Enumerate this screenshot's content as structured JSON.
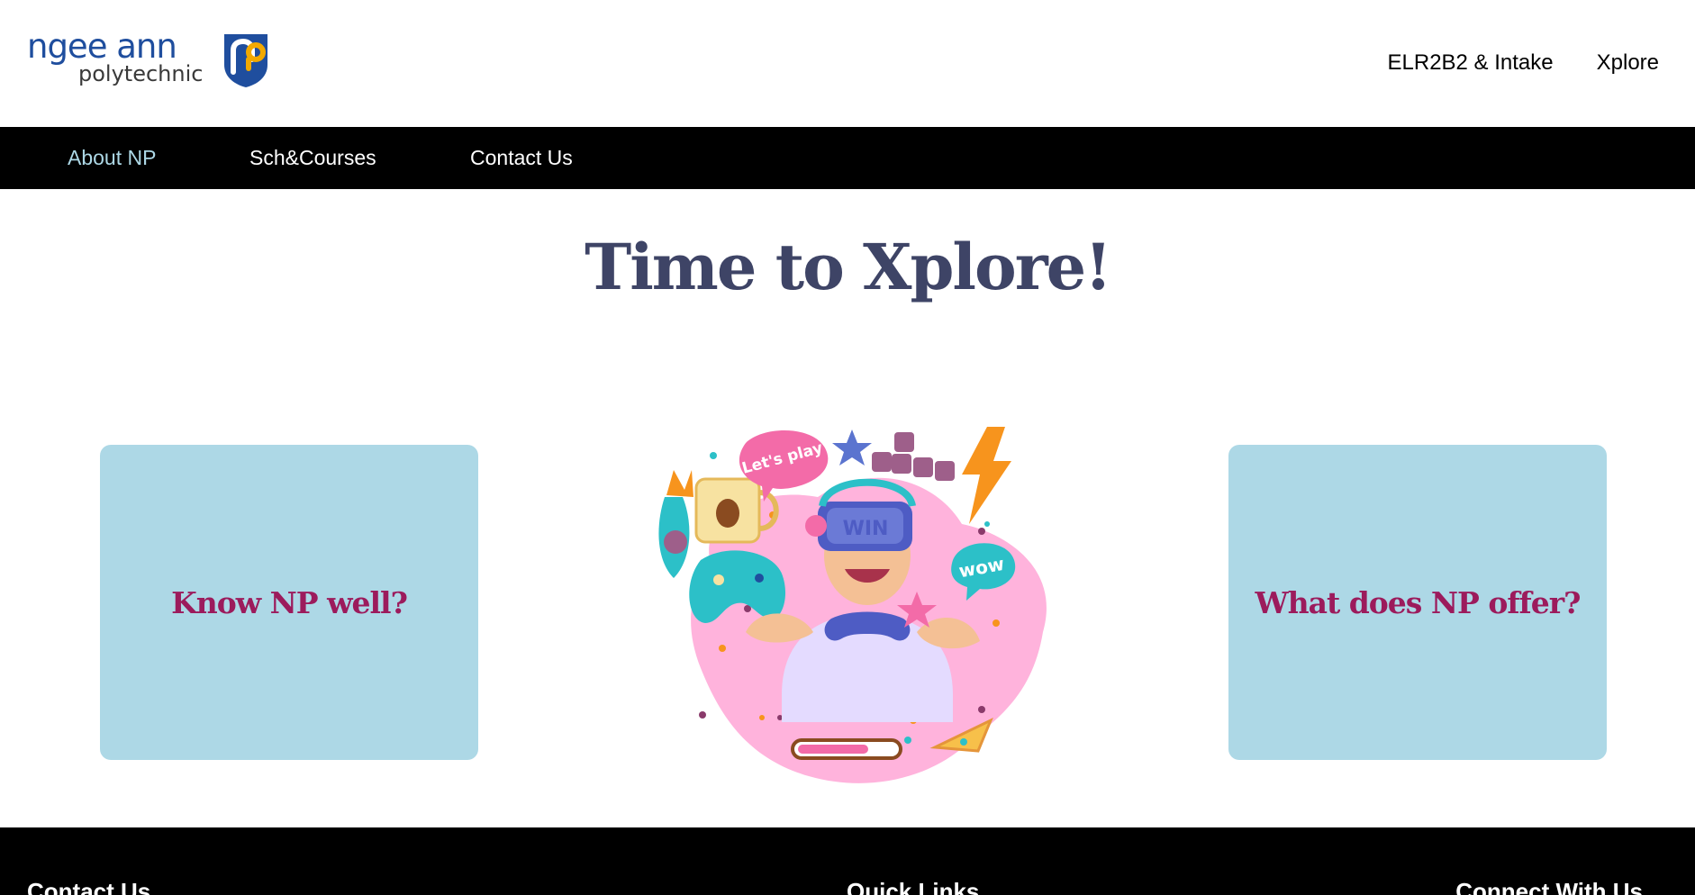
{
  "logo": {
    "line1": "ngee ann",
    "line2": "polytechnic",
    "shield_icon": "np-shield-logo-icon"
  },
  "top_nav": {
    "items": [
      {
        "label": "ELR2B2 & Intake"
      },
      {
        "label": "Xplore"
      }
    ]
  },
  "main_nav": {
    "items": [
      {
        "label": "About NP",
        "active": true
      },
      {
        "label": "Sch&Courses",
        "active": false
      },
      {
        "label": "Contact Us",
        "active": false
      }
    ]
  },
  "main": {
    "title": "Time to Xplore!",
    "cards": [
      {
        "label": "Know NP well?"
      },
      {
        "label": "What does NP offer?"
      }
    ],
    "illustration": {
      "icon": "gamer-vr-illustration",
      "bubble_1": "Let's play",
      "bubble_2": "wow",
      "headset_text": "WIN"
    }
  },
  "footer": {
    "headings": [
      {
        "label": "Contact Us"
      },
      {
        "label": "Quick Links"
      },
      {
        "label": "Connect With Us"
      }
    ]
  },
  "colors": {
    "brand_blue": "#1f4e9e",
    "nav_bg": "#000000",
    "active_nav": "#add8e6",
    "title": "#3e4466",
    "card_bg": "#add8e6",
    "card_text": "#9c1b5c"
  }
}
